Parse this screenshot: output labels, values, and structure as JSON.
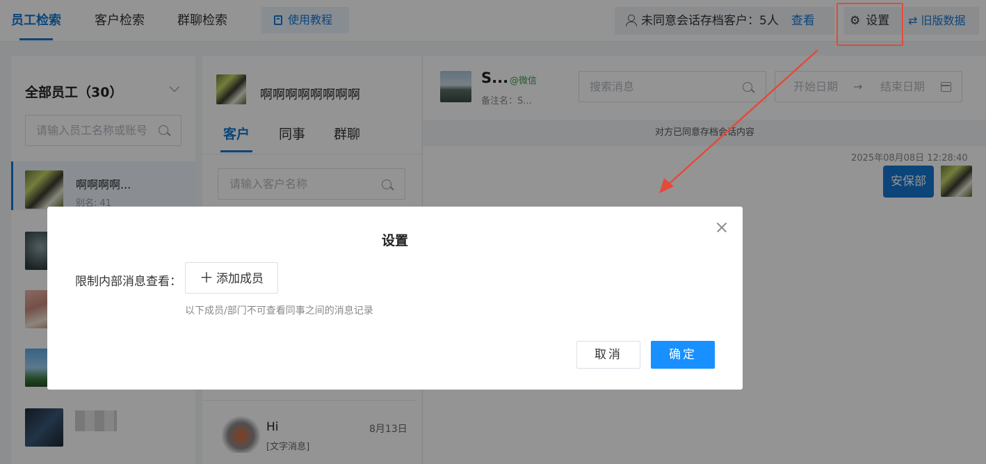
{
  "topbar": {
    "tabs": [
      "员工检索",
      "客户检索",
      "群聊检索"
    ],
    "tutorial_label": "使用教程",
    "consent_text": "未同意会话存档客户：5人",
    "consent_link": "查看",
    "settings_label": "设置",
    "old_data_label": "⇄ 旧版数据"
  },
  "employees": {
    "title": "全部员工（30）",
    "search_placeholder": "请输入员工名称或账号",
    "items": [
      {
        "name": "啊啊啊啊...",
        "alias": "别名: 41"
      }
    ]
  },
  "customers": {
    "employee_name": "啊啊啊啊啊啊啊啊",
    "tabs": [
      "客户",
      "同事",
      "群聊"
    ],
    "search_placeholder": "请输入客户名称",
    "chat": {
      "title": "Hi",
      "subtitle": "[文字消息]",
      "date": "8月13日"
    }
  },
  "conversation": {
    "name": "S...",
    "source": "@微信",
    "remark": "备注名：S...",
    "search_placeholder": "搜索消息",
    "start_date": "开始日期",
    "end_date": "结束日期",
    "range_arrow": "→",
    "banner": "对方已同意存档会话内容",
    "timestamp": "2025年08月08日 12:28:40",
    "message": "安保部"
  },
  "dialog": {
    "title": "设置",
    "field_label": "限制内部消息查看：",
    "add_member": "添加成员",
    "hint": "以下成员/部门不可查看同事之间的消息记录",
    "cancel": "取消",
    "confirm": "确定"
  },
  "colors": {
    "accent": "#1677d2",
    "primary_button": "#1890ff",
    "annotation_red": "#e24b3b"
  }
}
